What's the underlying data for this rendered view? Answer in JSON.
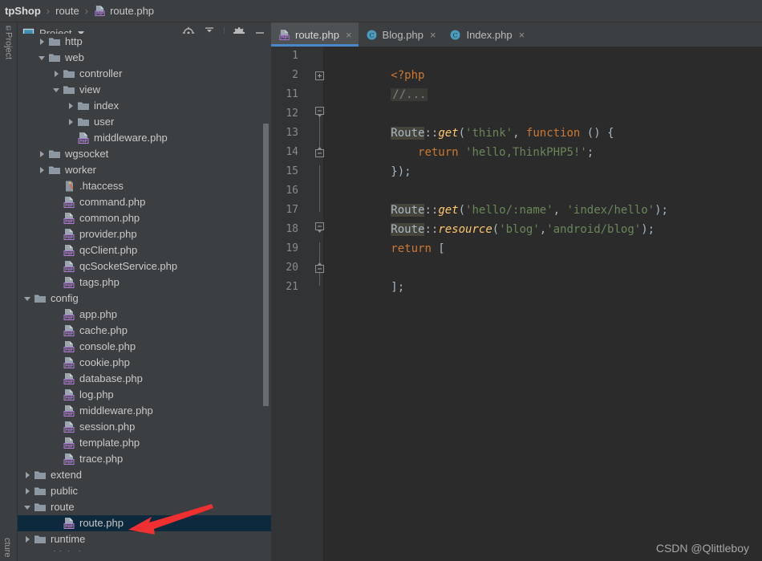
{
  "breadcrumb": {
    "project": "tpShop",
    "folder": "route",
    "file": "route.php",
    "separator": "›"
  },
  "stripe": {
    "project_label": "Project",
    "structure_label": "cture"
  },
  "project_panel": {
    "title": "Project",
    "tools": [
      {
        "name": "locate-icon",
        "tip": "Select Opened File"
      },
      {
        "name": "collapse-all-icon",
        "tip": "Collapse All"
      },
      {
        "name": "gear-icon",
        "tip": "Settings"
      },
      {
        "name": "minimize-icon",
        "tip": "Hide"
      }
    ],
    "tree": [
      {
        "label": "http",
        "indent": 1,
        "type": "folder",
        "state": "closed",
        "selected": false,
        "clipped": true
      },
      {
        "label": "web",
        "indent": 1,
        "type": "folder",
        "state": "open",
        "selected": false
      },
      {
        "label": "controller",
        "indent": 2,
        "type": "folder",
        "state": "closed",
        "selected": false
      },
      {
        "label": "view",
        "indent": 2,
        "type": "folder",
        "state": "open",
        "selected": false
      },
      {
        "label": "index",
        "indent": 3,
        "type": "folder",
        "state": "closed",
        "selected": false
      },
      {
        "label": "user",
        "indent": 3,
        "type": "folder",
        "state": "closed",
        "selected": false
      },
      {
        "label": "middleware.php",
        "indent": 3,
        "type": "php",
        "state": "leaf",
        "selected": false
      },
      {
        "label": "wgsocket",
        "indent": 1,
        "type": "folder",
        "state": "closed",
        "selected": false
      },
      {
        "label": "worker",
        "indent": 1,
        "type": "folder",
        "state": "closed",
        "selected": false
      },
      {
        "label": ".htaccess",
        "indent": 2,
        "type": "htaccess",
        "state": "leaf",
        "selected": false
      },
      {
        "label": "command.php",
        "indent": 2,
        "type": "php",
        "state": "leaf",
        "selected": false
      },
      {
        "label": "common.php",
        "indent": 2,
        "type": "php",
        "state": "leaf",
        "selected": false
      },
      {
        "label": "provider.php",
        "indent": 2,
        "type": "php",
        "state": "leaf",
        "selected": false
      },
      {
        "label": "qcClient.php",
        "indent": 2,
        "type": "php",
        "state": "leaf",
        "selected": false
      },
      {
        "label": "qcSocketService.php",
        "indent": 2,
        "type": "php",
        "state": "leaf",
        "selected": false
      },
      {
        "label": "tags.php",
        "indent": 2,
        "type": "php",
        "state": "leaf",
        "selected": false
      },
      {
        "label": "config",
        "indent": 0,
        "type": "folder",
        "state": "open",
        "selected": false
      },
      {
        "label": "app.php",
        "indent": 2,
        "type": "php",
        "state": "leaf",
        "selected": false
      },
      {
        "label": "cache.php",
        "indent": 2,
        "type": "php",
        "state": "leaf",
        "selected": false
      },
      {
        "label": "console.php",
        "indent": 2,
        "type": "php",
        "state": "leaf",
        "selected": false
      },
      {
        "label": "cookie.php",
        "indent": 2,
        "type": "php",
        "state": "leaf",
        "selected": false
      },
      {
        "label": "database.php",
        "indent": 2,
        "type": "php",
        "state": "leaf",
        "selected": false
      },
      {
        "label": "log.php",
        "indent": 2,
        "type": "php",
        "state": "leaf",
        "selected": false
      },
      {
        "label": "middleware.php",
        "indent": 2,
        "type": "php",
        "state": "leaf",
        "selected": false
      },
      {
        "label": "session.php",
        "indent": 2,
        "type": "php",
        "state": "leaf",
        "selected": false
      },
      {
        "label": "template.php",
        "indent": 2,
        "type": "php",
        "state": "leaf",
        "selected": false
      },
      {
        "label": "trace.php",
        "indent": 2,
        "type": "php",
        "state": "leaf",
        "selected": false
      },
      {
        "label": "extend",
        "indent": 0,
        "type": "folder",
        "state": "closed",
        "selected": false
      },
      {
        "label": "public",
        "indent": 0,
        "type": "folder",
        "state": "closed",
        "selected": false
      },
      {
        "label": "route",
        "indent": 0,
        "type": "folder",
        "state": "open",
        "selected": false
      },
      {
        "label": "route.php",
        "indent": 2,
        "type": "php",
        "state": "leaf",
        "selected": true
      },
      {
        "label": "runtime",
        "indent": 0,
        "type": "folder",
        "state": "closed",
        "selected": false
      },
      {
        "label": "thinkphp",
        "indent": 0,
        "type": "folder",
        "state": "closed",
        "selected": false,
        "clipped": true
      }
    ]
  },
  "editor": {
    "tabs": [
      {
        "label": "route.php",
        "icon": "php-file-icon",
        "active": true
      },
      {
        "label": "Blog.php",
        "icon": "php-class-icon",
        "active": false
      },
      {
        "label": "Index.php",
        "icon": "php-class-icon",
        "active": false
      }
    ],
    "close_glyph": "×",
    "line_numbers": [
      "1",
      "2",
      "11",
      "12",
      "13",
      "14",
      "15",
      "16",
      "17",
      "18",
      "19",
      "20",
      "21"
    ],
    "code": {
      "l1_php_open": "<?php",
      "l2_fold": "//...",
      "l12_ident": "Route",
      "l12_sep": "::",
      "l12_fn": "get",
      "l12_rest_open": "(",
      "l12_arg1": "'think'",
      "l12_comma": ", ",
      "l12_kw": "function",
      "l12_tail": " () {",
      "l13_kw": "return",
      "l13_str": "'hello,ThinkPHP5!'",
      "l13_semi": ";",
      "l14": "});",
      "l16_ident": "Route",
      "l16_sep": "::",
      "l16_fn": "get",
      "l16_open": "(",
      "l16_arg1": "'hello/:name'",
      "l16_comma": ", ",
      "l16_arg2": "'index/hello'",
      "l16_close": ");",
      "l17_ident": "Route",
      "l17_sep": "::",
      "l17_fn": "resource",
      "l17_open": "(",
      "l17_arg1": "'blog'",
      "l17_comma": ",",
      "l17_arg2": "'android/blog'",
      "l17_close": ");",
      "l18_kw": "return",
      "l18_bracket": " [",
      "l20": "];"
    }
  },
  "annotations": {
    "editor_arrow": "red-arrow-pointing-left",
    "tree_arrow": "red-arrow-pointing-left-down"
  },
  "watermark": "CSDN @Qlittleboy",
  "colors": {
    "accent_tab_underline": "#4a88c7",
    "selection_row": "#0d293e",
    "editor_bg": "#2b2b2b",
    "panel_bg": "#3c3f41",
    "gutter_bg": "#313335",
    "arrow_red": "#f03030",
    "string_green": "#6a8759",
    "keyword_orange": "#cc7832",
    "function_yellow": "#ffc66d",
    "identifier_grey": "#a9b7c6"
  }
}
